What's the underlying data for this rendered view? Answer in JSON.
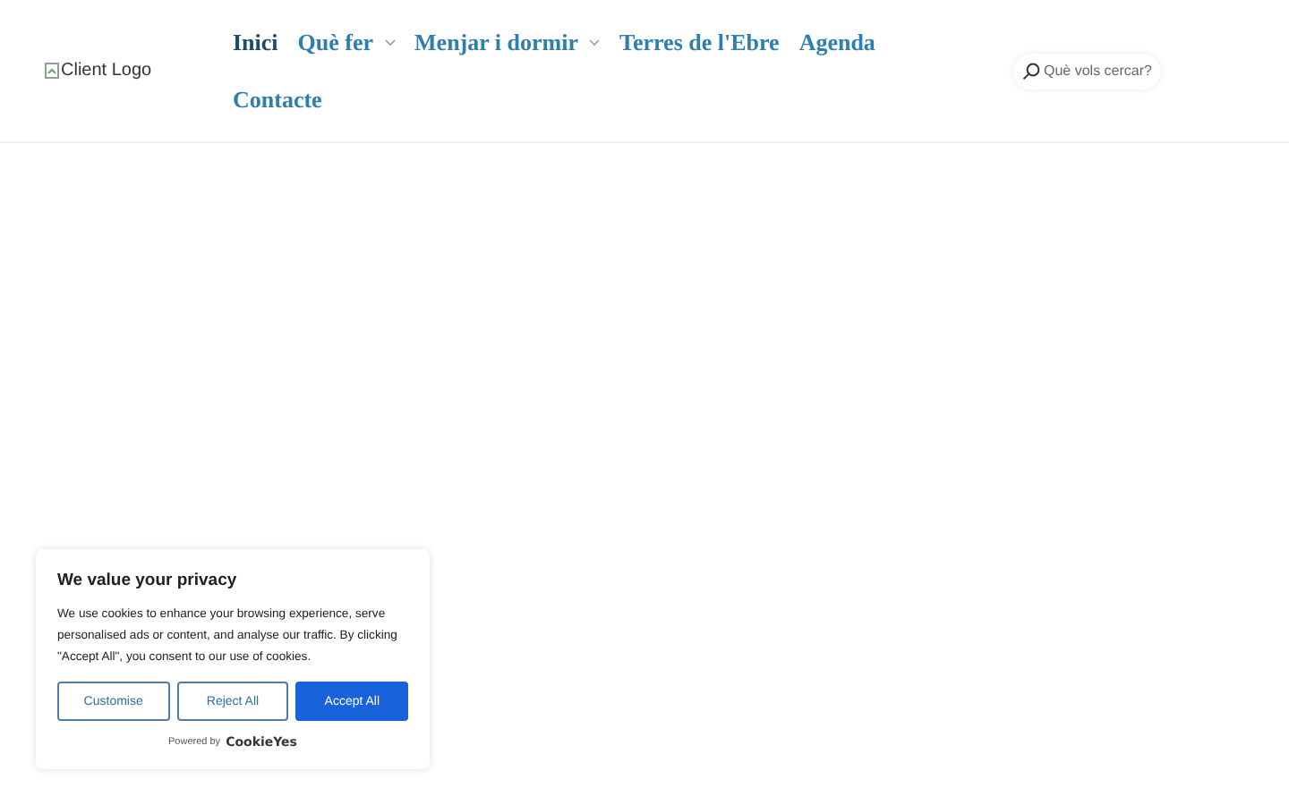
{
  "header": {
    "logo_alt": "Client Logo",
    "nav": [
      {
        "label": "Inici",
        "selected": true,
        "has_submenu": false
      },
      {
        "label": "Què fer",
        "selected": false,
        "has_submenu": true
      },
      {
        "label": "Menjar i dormir",
        "selected": false,
        "has_submenu": true
      },
      {
        "label": "Terres de l'Ebre",
        "selected": false,
        "has_submenu": false
      },
      {
        "label": "Agenda",
        "selected": false,
        "has_submenu": false
      },
      {
        "label": "Contacte",
        "selected": false,
        "has_submenu": false
      }
    ],
    "search": {
      "placeholder": "Què vols cercar?"
    }
  },
  "cookie_banner": {
    "title": "We value your privacy",
    "text": "We use cookies to enhance your browsing experience, serve personalised ads or content, and analyse our traffic. By clicking \"Accept All\", you consent to our use of cookies.",
    "buttons": [
      {
        "label": "Customise",
        "kind": "outline"
      },
      {
        "label": "Reject All",
        "kind": "outline"
      },
      {
        "label": "Accept All",
        "kind": "primary"
      }
    ],
    "powered_by": "Powered by",
    "brand": "CookieYes"
  }
}
